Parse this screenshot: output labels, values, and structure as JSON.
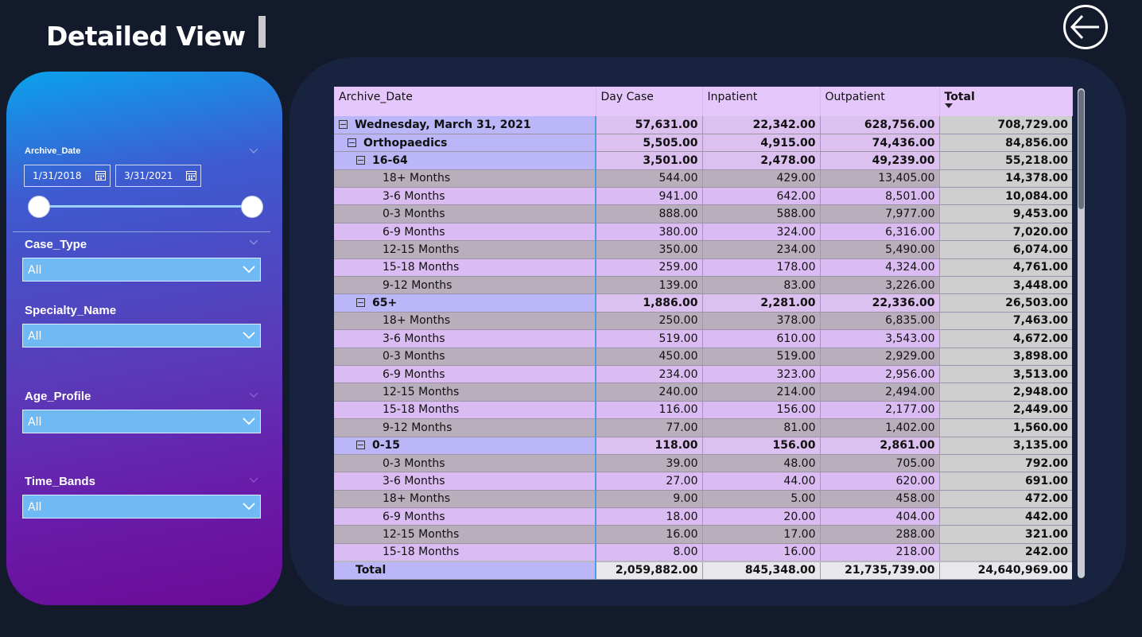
{
  "header": {
    "title": "Detailed View",
    "back_label": "back"
  },
  "filters": {
    "archive_date": {
      "title": "Archive_Date",
      "start": "1/31/2018",
      "end": "3/31/2021"
    },
    "case_type": {
      "title": "Case_Type",
      "value": "All"
    },
    "specialty_name": {
      "title": "Specialty_Name",
      "value": "All"
    },
    "age_profile": {
      "title": "Age_Profile",
      "value": "All"
    },
    "time_bands": {
      "title": "Time_Bands",
      "value": "All"
    }
  },
  "matrix": {
    "columns": [
      "Archive_Date",
      "Day Case",
      "Inpatient",
      "Outpatient",
      "Total"
    ],
    "rows": [
      {
        "level": 0,
        "type": "grp",
        "label": "Wednesday, March 31, 2021",
        "values": [
          "57,631.00",
          "22,342.00",
          "628,756.00",
          "708,729.00"
        ]
      },
      {
        "level": 1,
        "type": "grp",
        "label": "Orthopaedics",
        "values": [
          "5,505.00",
          "4,915.00",
          "74,436.00",
          "84,856.00"
        ]
      },
      {
        "level": 2,
        "type": "grp",
        "label": "16-64",
        "values": [
          "3,501.00",
          "2,478.00",
          "49,239.00",
          "55,218.00"
        ]
      },
      {
        "level": 3,
        "type": "a",
        "label": "18+ Months",
        "values": [
          "544.00",
          "429.00",
          "13,405.00",
          "14,378.00"
        ]
      },
      {
        "level": 3,
        "type": "b",
        "label": "3-6 Months",
        "values": [
          "941.00",
          "642.00",
          "8,501.00",
          "10,084.00"
        ]
      },
      {
        "level": 3,
        "type": "a",
        "label": "0-3 Months",
        "values": [
          "888.00",
          "588.00",
          "7,977.00",
          "9,453.00"
        ]
      },
      {
        "level": 3,
        "type": "b",
        "label": "6-9 Months",
        "values": [
          "380.00",
          "324.00",
          "6,316.00",
          "7,020.00"
        ]
      },
      {
        "level": 3,
        "type": "a",
        "label": "12-15 Months",
        "values": [
          "350.00",
          "234.00",
          "5,490.00",
          "6,074.00"
        ]
      },
      {
        "level": 3,
        "type": "b",
        "label": "15-18 Months",
        "values": [
          "259.00",
          "178.00",
          "4,324.00",
          "4,761.00"
        ]
      },
      {
        "level": 3,
        "type": "a",
        "label": "9-12 Months",
        "values": [
          "139.00",
          "83.00",
          "3,226.00",
          "3,448.00"
        ]
      },
      {
        "level": 2,
        "type": "grp",
        "label": "65+",
        "values": [
          "1,886.00",
          "2,281.00",
          "22,336.00",
          "26,503.00"
        ]
      },
      {
        "level": 3,
        "type": "a",
        "label": "18+ Months",
        "values": [
          "250.00",
          "378.00",
          "6,835.00",
          "7,463.00"
        ]
      },
      {
        "level": 3,
        "type": "b",
        "label": "3-6 Months",
        "values": [
          "519.00",
          "610.00",
          "3,543.00",
          "4,672.00"
        ]
      },
      {
        "level": 3,
        "type": "a",
        "label": "0-3 Months",
        "values": [
          "450.00",
          "519.00",
          "2,929.00",
          "3,898.00"
        ]
      },
      {
        "level": 3,
        "type": "b",
        "label": "6-9 Months",
        "values": [
          "234.00",
          "323.00",
          "2,956.00",
          "3,513.00"
        ]
      },
      {
        "level": 3,
        "type": "a",
        "label": "12-15 Months",
        "values": [
          "240.00",
          "214.00",
          "2,494.00",
          "2,948.00"
        ]
      },
      {
        "level": 3,
        "type": "b",
        "label": "15-18 Months",
        "values": [
          "116.00",
          "156.00",
          "2,177.00",
          "2,449.00"
        ]
      },
      {
        "level": 3,
        "type": "a",
        "label": "9-12 Months",
        "values": [
          "77.00",
          "81.00",
          "1,402.00",
          "1,560.00"
        ]
      },
      {
        "level": 2,
        "type": "grp",
        "label": "0-15",
        "values": [
          "118.00",
          "156.00",
          "2,861.00",
          "3,135.00"
        ]
      },
      {
        "level": 3,
        "type": "a",
        "label": "0-3 Months",
        "values": [
          "39.00",
          "48.00",
          "705.00",
          "792.00"
        ]
      },
      {
        "level": 3,
        "type": "b",
        "label": "3-6 Months",
        "values": [
          "27.00",
          "44.00",
          "620.00",
          "691.00"
        ]
      },
      {
        "level": 3,
        "type": "a",
        "label": "18+ Months",
        "values": [
          "9.00",
          "5.00",
          "458.00",
          "472.00"
        ]
      },
      {
        "level": 3,
        "type": "b",
        "label": "6-9 Months",
        "values": [
          "18.00",
          "20.00",
          "404.00",
          "442.00"
        ]
      },
      {
        "level": 3,
        "type": "a",
        "label": "12-15 Months",
        "values": [
          "16.00",
          "17.00",
          "288.00",
          "321.00"
        ]
      },
      {
        "level": 3,
        "type": "b",
        "label": "15-18 Months",
        "values": [
          "8.00",
          "16.00",
          "218.00",
          "242.00"
        ]
      }
    ],
    "total": {
      "label": "Total",
      "values": [
        "2,059,882.00",
        "845,348.00",
        "21,735,739.00",
        "24,640,969.00"
      ]
    }
  }
}
